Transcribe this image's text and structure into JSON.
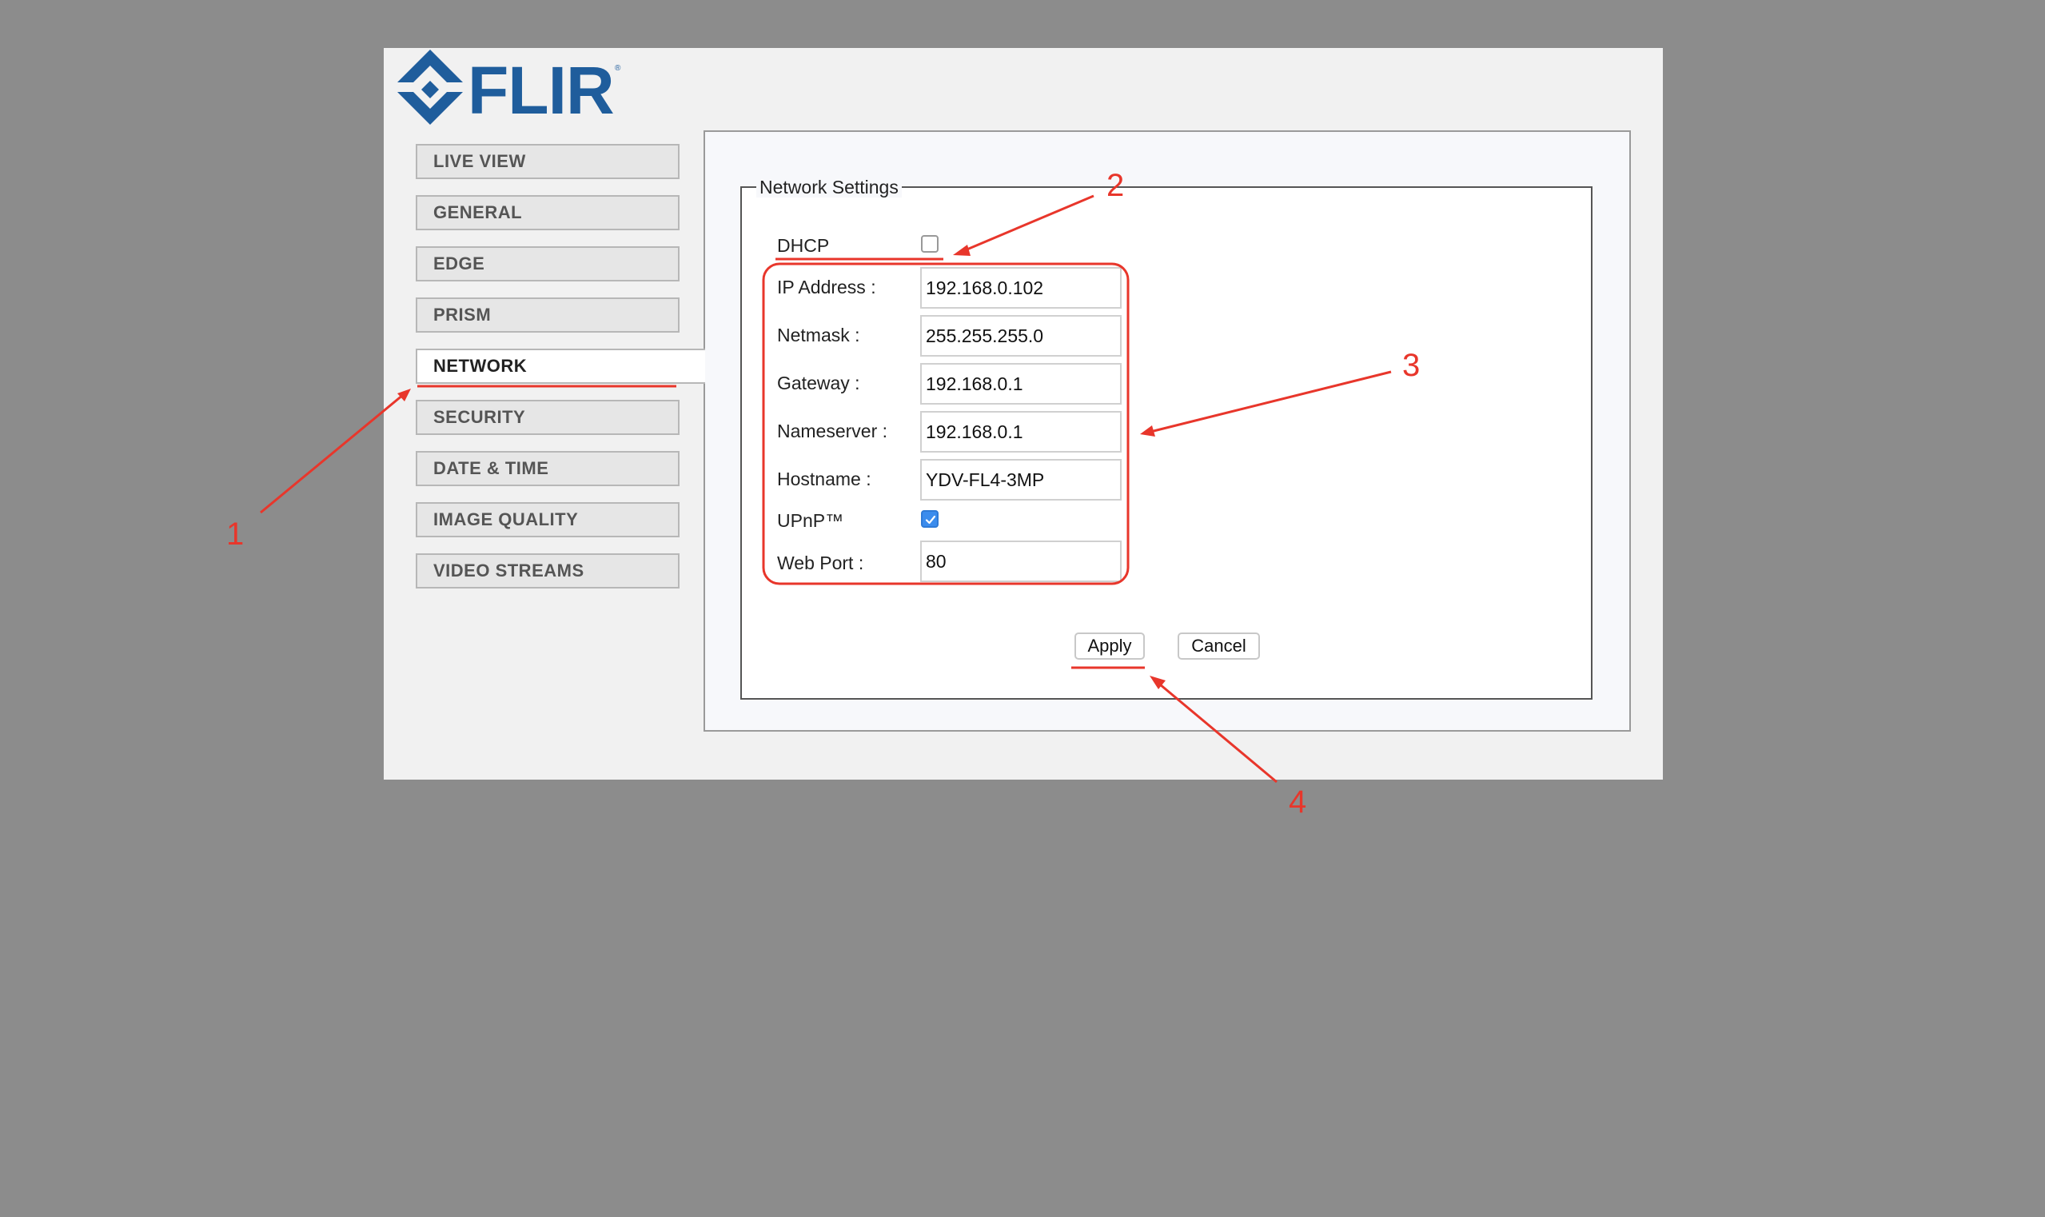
{
  "logo": {
    "text": "FLIR",
    "registered_mark": "®",
    "brand_color": "#1f5d9c"
  },
  "sidebar": {
    "items": [
      {
        "label": "LIVE VIEW",
        "active": false
      },
      {
        "label": "GENERAL",
        "active": false
      },
      {
        "label": "EDGE",
        "active": false
      },
      {
        "label": "PRISM",
        "active": false
      },
      {
        "label": "NETWORK",
        "active": true
      },
      {
        "label": "SECURITY",
        "active": false
      },
      {
        "label": "DATE & TIME",
        "active": false
      },
      {
        "label": "IMAGE QUALITY",
        "active": false
      },
      {
        "label": "VIDEO STREAMS",
        "active": false
      }
    ]
  },
  "network_settings": {
    "legend": "Network Settings",
    "dhcp": {
      "label": "DHCP",
      "checked": false
    },
    "ip_address": {
      "label": "IP Address :",
      "value": "192.168.0.102"
    },
    "netmask": {
      "label": "Netmask :",
      "value": "255.255.255.0"
    },
    "gateway": {
      "label": "Gateway :",
      "value": "192.168.0.1"
    },
    "nameserver": {
      "label": "Nameserver :",
      "value": "192.168.0.1"
    },
    "hostname": {
      "label": "Hostname :",
      "value": "YDV-FL4-3MP"
    },
    "upnp": {
      "label": "UPnP™",
      "checked": true
    },
    "web_port": {
      "label": "Web Port :",
      "value": "80"
    }
  },
  "buttons": {
    "apply": "Apply",
    "cancel": "Cancel"
  },
  "annotations": {
    "color": "#e8362b",
    "callouts": [
      "1",
      "2",
      "3",
      "4"
    ]
  },
  "colors": {
    "background": "#8c8c8c",
    "panel": "#f1f1f1",
    "checkbox_checked": "#3b8ced"
  }
}
